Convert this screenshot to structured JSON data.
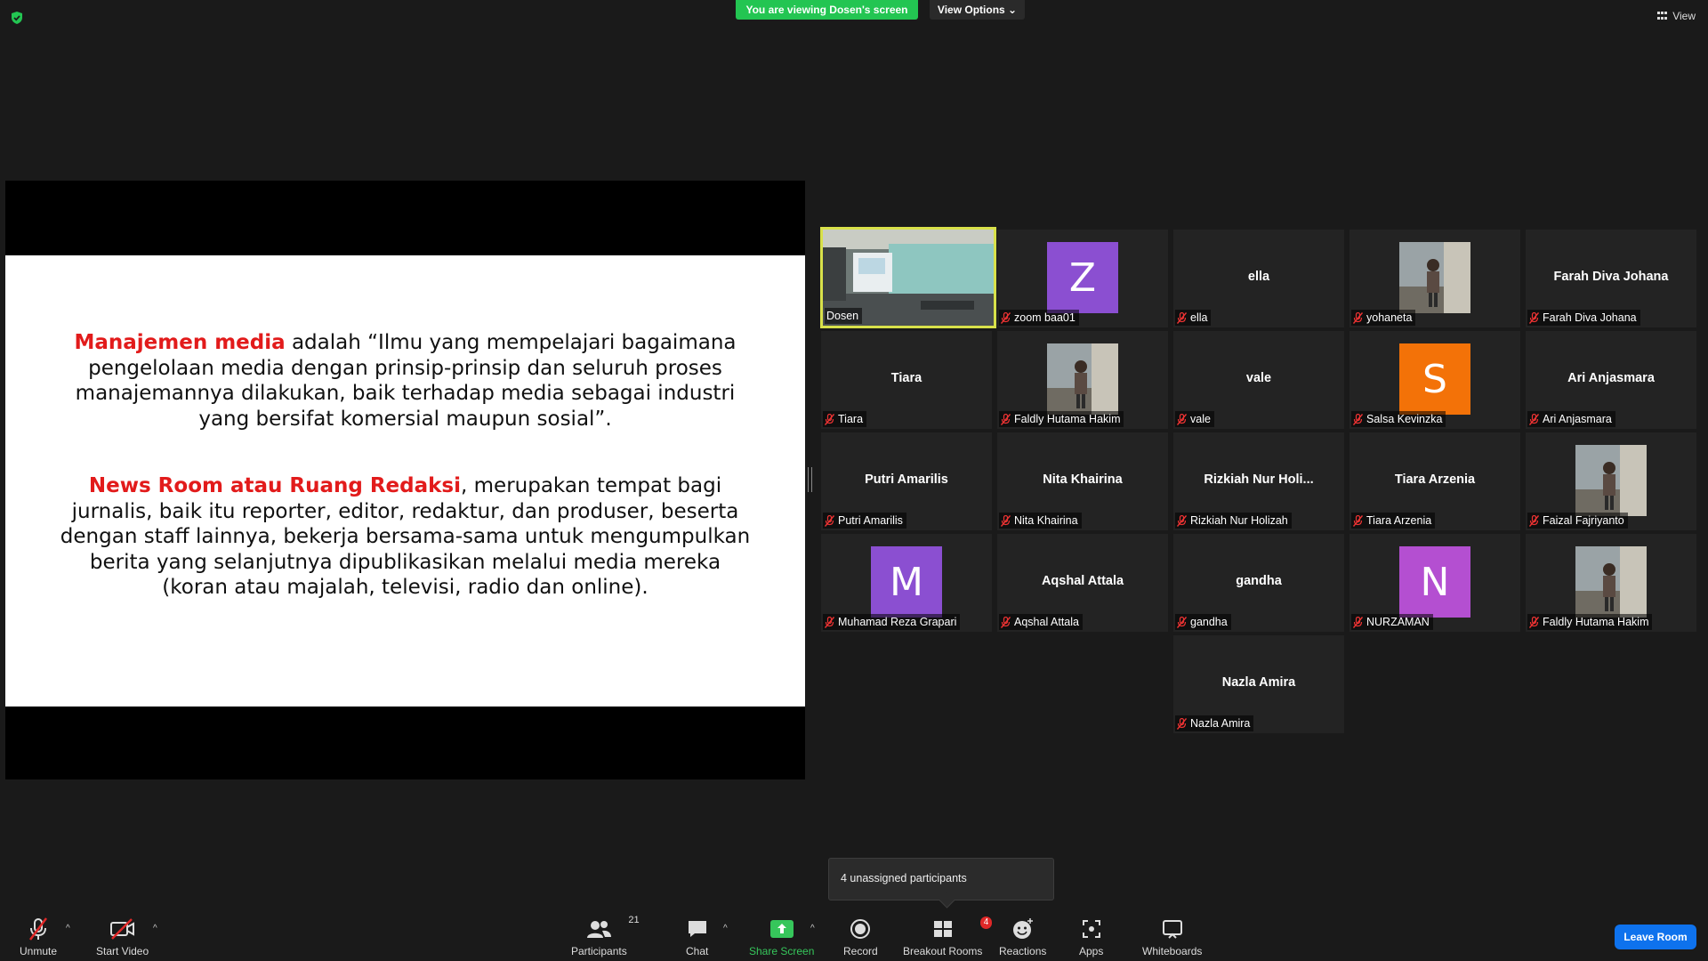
{
  "top": {
    "banner": "You are viewing Dosen's screen",
    "view_options": "View Options ⌄",
    "view": "View"
  },
  "slide": {
    "p1_bold": "Manajemen media",
    "p1_rest": " adalah “Ilmu yang mempelajari bagaimana pengelolaan media dengan prinsip-prinsip dan seluruh proses manajemannya dilakukan, baik terhadap media sebagai industri yang bersifat komersial maupun sosial”.",
    "p2_bold": "News Room atau Ruang Redaksi",
    "p2_rest": ", merupakan tempat bagi jurnalis, baik itu reporter, editor, redaktur, dan produser, beserta dengan staff lainnya, bekerja bersama-sama untuk mengumpulkan berita yang selanjutnya dipublikasikan melalui media mereka (koran atau majalah, televisi, radio dan online)."
  },
  "participants": [
    {
      "label": "Dosen",
      "type": "video"
    },
    {
      "label": "zoom baa01",
      "type": "avatar",
      "letter": "Z",
      "color": "#8b4fd1"
    },
    {
      "label": "ella",
      "type": "name",
      "center": "ella"
    },
    {
      "label": "yohaneta",
      "type": "photo"
    },
    {
      "label": "Farah Diva Johana",
      "type": "name",
      "center": "Farah Diva Johana"
    },
    {
      "label": "Tiara",
      "type": "name",
      "center": "Tiara"
    },
    {
      "label": "Faldly Hutama Hakim",
      "type": "photo"
    },
    {
      "label": "vale",
      "type": "name",
      "center": "vale"
    },
    {
      "label": "Salsa Kevinzka",
      "type": "avatar",
      "letter": "S",
      "color": "#f37208"
    },
    {
      "label": "Ari Anjasmara",
      "type": "name",
      "center": "Ari Anjasmara"
    },
    {
      "label": "Putri Amarilis",
      "type": "name",
      "center": "Putri Amarilis"
    },
    {
      "label": "Nita Khairina",
      "type": "name",
      "center": "Nita Khairina"
    },
    {
      "label": "Rizkiah Nur Holizah",
      "type": "name",
      "center": "Rizkiah  Nur  Holi..."
    },
    {
      "label": "Tiara Arzenia",
      "type": "name",
      "center": "Tiara Arzenia"
    },
    {
      "label": "Faizal Fajriyanto",
      "type": "photo"
    },
    {
      "label": "Muhamad Reza Grapari",
      "type": "avatar",
      "letter": "M",
      "color": "#8b4fd1"
    },
    {
      "label": "Aqshal Attala",
      "type": "name",
      "center": "Aqshal Attala"
    },
    {
      "label": "gandha",
      "type": "name",
      "center": "gandha"
    },
    {
      "label": "NURZAMAN",
      "type": "avatar",
      "letter": "N",
      "color": "#b44fd1"
    },
    {
      "label": "Faldly Hutama Hakim",
      "type": "photo"
    },
    {
      "label": "Nazla Amira",
      "type": "name",
      "center": "Nazla Amira"
    }
  ],
  "popup": "4 unassigned participants",
  "toolbar": {
    "unmute": "Unmute",
    "start_video": "Start Video",
    "participants": "Participants",
    "participants_count": "21",
    "chat": "Chat",
    "share_screen": "Share Screen",
    "record": "Record",
    "breakout_rooms": "Breakout Rooms",
    "breakout_badge": "4",
    "reactions": "Reactions",
    "apps": "Apps",
    "whiteboards": "Whiteboards",
    "leave": "Leave Room"
  }
}
